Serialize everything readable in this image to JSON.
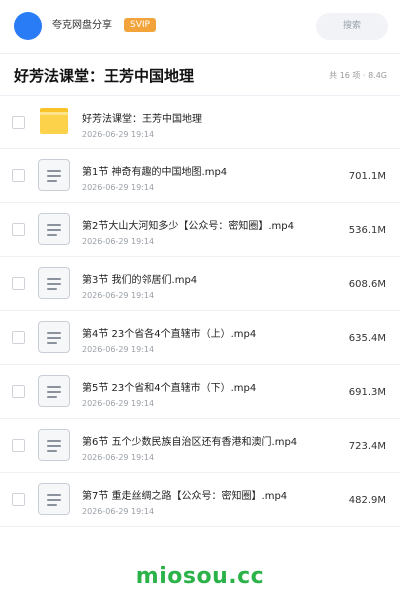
{
  "header": {
    "share_name": "夸克网盘分享",
    "badge": "SVIP",
    "search_label": "搜索",
    "avatar_color": "#2a7bf6"
  },
  "folder": {
    "title": "好芳法课堂：王芳中国地理",
    "meta": "共 16 项 · 8.4G"
  },
  "files": [
    {
      "type": "folder",
      "icon": "folder-icon",
      "name": "好芳法课堂：王芳中国地理",
      "date": "2026-06-29 19:14",
      "size": ""
    },
    {
      "type": "file",
      "icon": "document-icon",
      "name": "第1节 神奇有趣的中国地图.mp4",
      "date": "2026-06-29 19:14",
      "size": "701.1M"
    },
    {
      "type": "file",
      "icon": "document-icon",
      "name": "第2节大山大河知多少【公众号：密知圈】.mp4",
      "date": "2026-06-29 19:14",
      "size": "536.1M"
    },
    {
      "type": "file",
      "icon": "document-icon",
      "name": "第3节 我们的邻居们.mp4",
      "date": "2026-06-29 19:14",
      "size": "608.6M"
    },
    {
      "type": "file",
      "icon": "document-icon",
      "name": "第4节 23个省各4个直辖市（上）.mp4",
      "date": "2026-06-29 19:14",
      "size": "635.4M"
    },
    {
      "type": "file",
      "icon": "document-icon",
      "name": "第5节 23个省和4个直辖市（下）.mp4",
      "date": "2026-06-29 19:14",
      "size": "691.3M"
    },
    {
      "type": "file",
      "icon": "document-icon",
      "name": "第6节 五个少数民族自治区还有香港和澳门.mp4",
      "date": "2026-06-29 19:14",
      "size": "723.4M"
    },
    {
      "type": "file",
      "icon": "document-icon",
      "name": "第7节 重走丝绸之路【公众号：密知圈】.mp4",
      "date": "2026-06-29 19:14",
      "size": "482.9M"
    }
  ],
  "watermark": "miosou.cc",
  "colors": {
    "accent": "#2a7bf6",
    "svip": "#f2a33a",
    "folder": "#fbd24a",
    "watermark": "#2bb34a"
  }
}
